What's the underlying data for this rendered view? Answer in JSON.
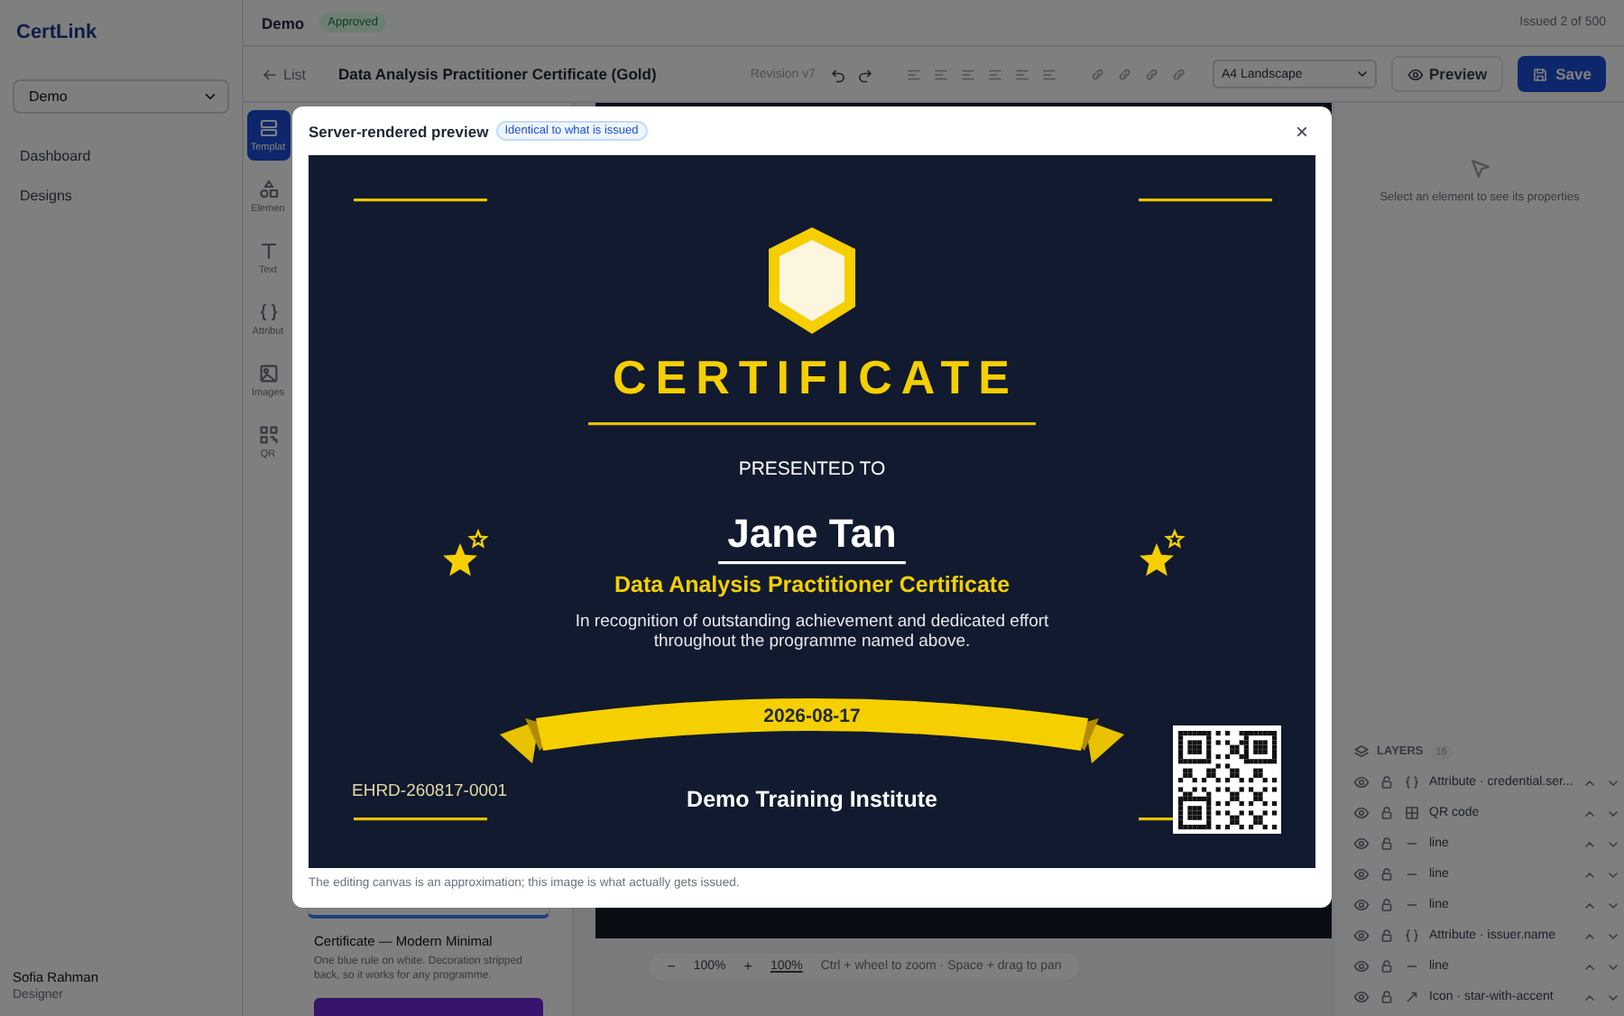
{
  "sidebar": {
    "brand": "CertLink",
    "workspace_select": "Demo",
    "nav": [
      {
        "label": "Dashboard",
        "selected": false
      },
      {
        "label": "Designs",
        "selected": false
      }
    ],
    "user": {
      "name": "Sofia Rahman",
      "role": "Designer"
    }
  },
  "header": {
    "workspace": "Demo",
    "status_badge": "Approved",
    "issued": "Issued 2 of 500"
  },
  "toolbar": {
    "back": "List",
    "title": "Data Analysis Practitioner Certificate (Gold)",
    "revision": "Revision v7",
    "page_size": "A4 Landscape",
    "preview": "Preview",
    "save": "Save"
  },
  "rail": [
    {
      "label": "Templat",
      "kind": "templates",
      "selected": true
    },
    {
      "label": "Elemen",
      "kind": "elements",
      "selected": false
    },
    {
      "label": "Text",
      "kind": "text",
      "selected": false
    },
    {
      "label": "Attribut",
      "kind": "attributes",
      "selected": false
    },
    {
      "label": "Images",
      "kind": "images",
      "selected": false
    },
    {
      "label": "QR",
      "kind": "qr",
      "selected": false
    }
  ],
  "template_card": {
    "title": "Certificate — Modern Minimal",
    "description": "One blue rule on white. Decoration stripped back, so it works for any programme."
  },
  "zoom_bar": {
    "zoom_out": "−",
    "zoom": "100%",
    "zoom_in": "+",
    "reset": "100%",
    "hint": "Ctrl + wheel to zoom · Space + drag to pan"
  },
  "properties": {
    "empty_hint": "Select an element to see its properties"
  },
  "layers": {
    "title": "LAYERS",
    "count": "16",
    "items": [
      {
        "label": "Attribute · credential.ser...",
        "kind": "attribute"
      },
      {
        "label": "QR code",
        "kind": "qr"
      },
      {
        "label": "line",
        "kind": "line"
      },
      {
        "label": "line",
        "kind": "line"
      },
      {
        "label": "line",
        "kind": "line"
      },
      {
        "label": "Attribute · issuer.name",
        "kind": "attribute"
      },
      {
        "label": "line",
        "kind": "line"
      },
      {
        "label": "Icon · star-with-accent",
        "kind": "icon"
      }
    ]
  },
  "modal": {
    "title": "Server-rendered preview",
    "badge": "Identical to what is issued",
    "close": "×",
    "footnote": "The editing canvas is an approximation; this image is what actually gets issued.",
    "certificate": {
      "heading": "CERTIFICATE",
      "presented_to": "PRESENTED TO",
      "recipient": "Jane Tan",
      "course": "Data Analysis Practitioner Certificate",
      "description": [
        "In recognition of outstanding achievement and dedicated effort",
        "throughout the programme named above."
      ],
      "date": "2026-08-17",
      "serial": "EHRD-260817-0001",
      "issuer": "Demo Training Institute"
    }
  }
}
